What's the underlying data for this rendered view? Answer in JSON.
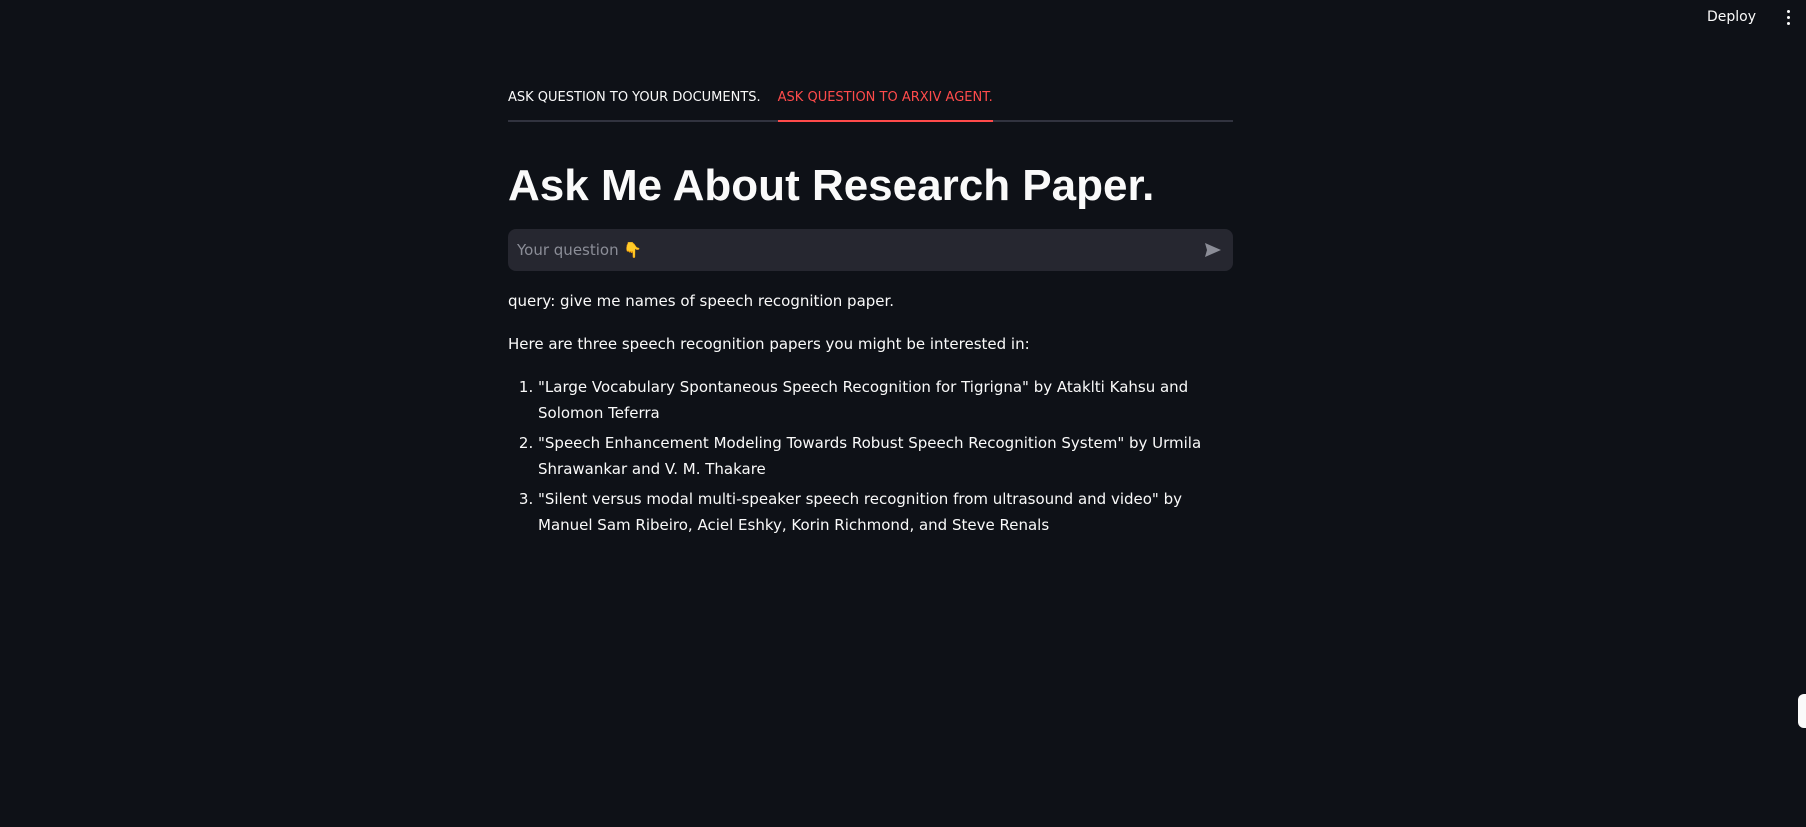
{
  "header": {
    "deploy_label": "Deploy",
    "menu_icon": "kebab-menu-icon"
  },
  "tabs": [
    {
      "label": "ASK QUESTION TO YOUR DOCUMENTS.",
      "active": false
    },
    {
      "label": "ASK QUESTION TO ARXIV AGENT.",
      "active": true
    }
  ],
  "page": {
    "title": "Ask Me About Research Paper."
  },
  "chat_input": {
    "value": "",
    "placeholder": "Your question 👇",
    "send_icon": "send-icon"
  },
  "response": {
    "query_line": "query: give me names of speech recognition paper.",
    "intro": "Here are three speech recognition papers you might be interested in:",
    "items": [
      "\"Large Vocabulary Spontaneous Speech Recognition for Tigrigna\" by Ataklti Kahsu and Solomon Teferra",
      "\"Speech Enhancement Modeling Towards Robust Speech Recognition System\" by Urmila Shrawankar and V. M. Thakare",
      "\"Silent versus modal multi-speaker speech recognition from ultrasound and video\" by Manuel Sam Ribeiro, Aciel Eshky, Korin Richmond, and Steve Renals"
    ]
  },
  "colors": {
    "background": "#0e1117",
    "accent": "#ff4b4b",
    "input_bg": "#262730",
    "text": "#fafafa"
  }
}
